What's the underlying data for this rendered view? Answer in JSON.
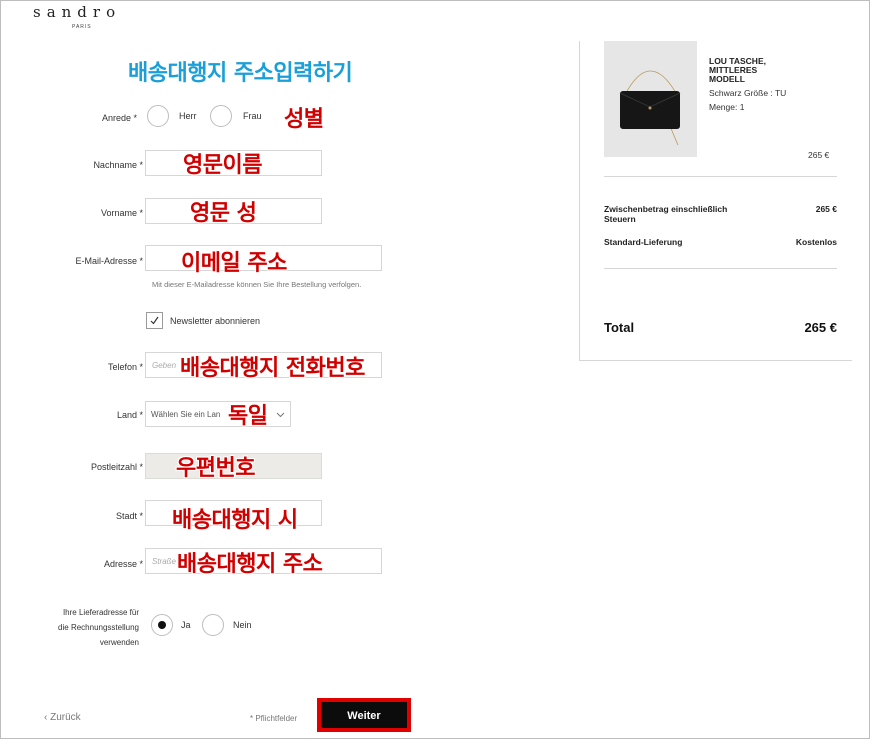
{
  "brand": {
    "name": "sandro",
    "sub": "PARIS"
  },
  "annotations": {
    "title": "배송대행지 주소입력하기",
    "gender": "성별",
    "lastname": "영문이름",
    "firstname": "영문 성",
    "email": "이메일 주소",
    "phone": "배송대행지 전화번호",
    "country": "독일",
    "postal": "우편번호",
    "city": "배송대행지 시",
    "address": "배송대행지 주소"
  },
  "form": {
    "anrede": {
      "label": "Anrede",
      "req": "*",
      "opt_herr": "Herr",
      "opt_frau": "Frau"
    },
    "nachname": {
      "label": "Nachname",
      "req": "*"
    },
    "vorname": {
      "label": "Vorname",
      "req": "*"
    },
    "email": {
      "label": "E-Mail-Adresse",
      "req": "*",
      "hint": "Mit dieser E-Mailadresse können Sie Ihre Bestellung verfolgen."
    },
    "newsletter": {
      "label": "Newsletter abonnieren",
      "checked": true
    },
    "telefon": {
      "label": "Telefon",
      "req": "*",
      "placeholder": "Geben"
    },
    "land": {
      "label": "Land",
      "req": "*",
      "value": "Wählen Sie ein Lan"
    },
    "plz": {
      "label": "Postleitzahl",
      "req": "*"
    },
    "stadt": {
      "label": "Stadt",
      "req": "*"
    },
    "adresse": {
      "label": "Adresse",
      "req": "*",
      "placeholder": "Straße"
    },
    "billing": {
      "label_1": "Ihre Lieferadresse für",
      "label_2": "die Rechnungsstellung",
      "label_3": "verwenden",
      "opt_ja": "Ja",
      "opt_nein": "Nein",
      "selected": "Ja"
    }
  },
  "cart": {
    "product": {
      "title_1": "LOU TASCHE,",
      "title_2": "MITTLERES",
      "title_3": "MODELL",
      "meta_1": "Schwarz Größe : TU",
      "meta_2": "Menge: 1",
      "price": "265 €"
    },
    "subtotal": {
      "label_1": "Zwischenbetrag einschließlich",
      "label_2": "Steuern",
      "value": "265 €"
    },
    "shipping": {
      "label": "Standard-Lieferung",
      "value": "Kostenlos"
    },
    "total": {
      "label": "Total",
      "value": "265 €"
    }
  },
  "footer": {
    "back": "Zurück",
    "required": "* Pflichtfelder",
    "next": "Weiter"
  },
  "colors": {
    "annotation_red": "#d10000",
    "annotation_blue": "#1a9fd8",
    "button": "#0c0c0c",
    "highlight": "#e00000"
  }
}
